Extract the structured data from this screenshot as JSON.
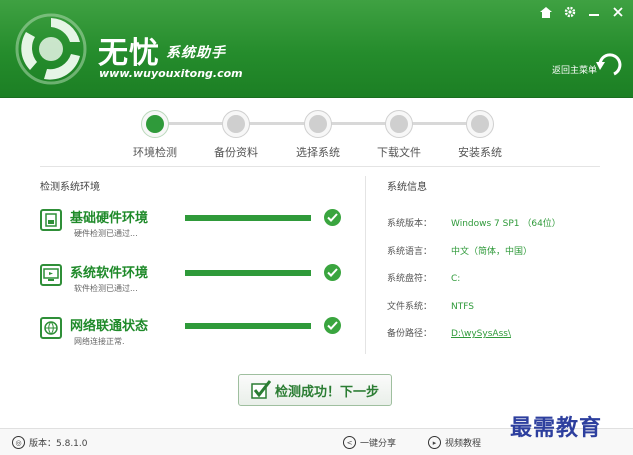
{
  "app": {
    "title": "无忧",
    "subtitle": "系统助手",
    "url": "www.wuyouxitong.com",
    "back_main_label": "返回主菜单"
  },
  "window_controls": [
    "home-icon",
    "gear-icon",
    "minimize-icon",
    "close-icon"
  ],
  "steps": [
    {
      "label": "环境检测",
      "active": true
    },
    {
      "label": "备份资料",
      "active": false
    },
    {
      "label": "选择系统",
      "active": false
    },
    {
      "label": "下载文件",
      "active": false
    },
    {
      "label": "安装系统",
      "active": false
    }
  ],
  "check": {
    "title": "检测系统环境",
    "items": [
      {
        "name": "基础硬件环境",
        "sub": "硬件检测已通过...",
        "progress": 1.0,
        "icon": "hardware-icon"
      },
      {
        "name": "系统软件环境",
        "sub": "软件检测已通过...",
        "progress": 1.0,
        "icon": "software-icon"
      },
      {
        "name": "网络联通状态",
        "sub": "网络连接正常.",
        "progress": 1.0,
        "icon": "network-icon"
      }
    ]
  },
  "sysinfo": {
    "title": "系统信息",
    "rows": [
      {
        "label": "系统版本：",
        "value": "Windows 7 SP1 （64位）"
      },
      {
        "label": "系统语言：",
        "value": "中文（简体，中国）"
      },
      {
        "label": "系统盘符：",
        "value": "C:"
      },
      {
        "label": "文件系统：",
        "value": "NTFS"
      },
      {
        "label": "备份路径：",
        "value": "D:\\wySysAss\\"
      }
    ]
  },
  "next_button": {
    "label": "检测成功！下一步"
  },
  "footer": {
    "version": "版本：5.8.1.0",
    "share": "一键分享",
    "video": "视频教程"
  },
  "watermark": "最需教育",
  "colors": {
    "brand_green": "#258c2c",
    "accent_green": "#2f9a3a",
    "watermark_blue": "#2d3f9e"
  }
}
